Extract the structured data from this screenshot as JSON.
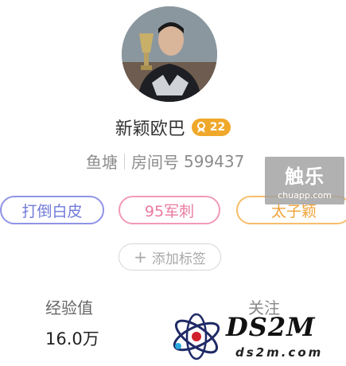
{
  "profile": {
    "nickname": "新颖欧巴",
    "level": "22",
    "category": "鱼塘",
    "room_id_label": "房间号",
    "room_id": "599437"
  },
  "tags": [
    "打倒白皮",
    "95军刺",
    "太子颖"
  ],
  "add_tag_label": "添加标签",
  "add_tag_icon": "+",
  "stats": {
    "exp_label": "经验值",
    "exp_value": "16.0万",
    "follow_label": "关注"
  },
  "watermarks": {
    "chuapp_title": "触乐",
    "chuapp_url": "chuapp.com",
    "ds2m_title": "DS2M",
    "ds2m_url": "ds2m.com"
  },
  "colors": {
    "level_badge": "#f0a82a",
    "tag_1": "#7079d8",
    "tag_2": "#e97aa0",
    "tag_3": "#f0a33a"
  }
}
